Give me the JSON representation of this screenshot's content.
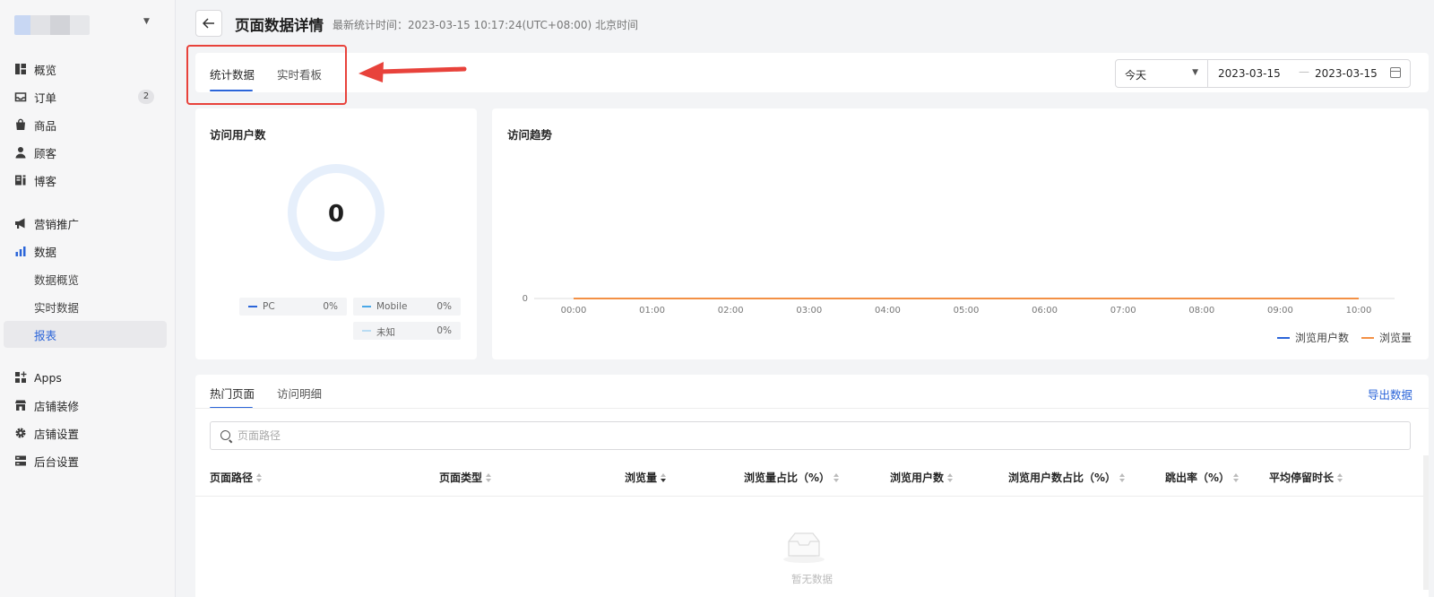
{
  "sidebar": {
    "items": [
      {
        "label": "概览",
        "icon": "dashboard-icon"
      },
      {
        "label": "订单",
        "icon": "inbox-icon",
        "badge": "2"
      },
      {
        "label": "商品",
        "icon": "shopping-bag-icon"
      },
      {
        "label": "顾客",
        "icon": "user-icon"
      },
      {
        "label": "博客",
        "icon": "blog-icon"
      },
      {
        "label": "营销推广",
        "icon": "megaphone-icon"
      },
      {
        "label": "数据",
        "icon": "bar-chart-icon"
      },
      {
        "label": "数据概览"
      },
      {
        "label": "实时数据"
      },
      {
        "label": "报表",
        "active": true
      },
      {
        "label": "Apps",
        "icon": "apps-icon"
      },
      {
        "label": "店铺装修",
        "icon": "storefront-icon"
      },
      {
        "label": "店铺设置",
        "icon": "gear-icon"
      },
      {
        "label": "后台设置",
        "icon": "server-icon"
      }
    ]
  },
  "header": {
    "title": "页面数据详情",
    "stat_time": "最新统计时间：2023-03-15 10:17:24(UTC+08:00) 北京时间"
  },
  "top_tabs": [
    {
      "label": "统计数据",
      "active": true
    },
    {
      "label": "实时看板"
    }
  ],
  "date_filter": {
    "range": "今天",
    "start": "2023-03-15",
    "separator": "—",
    "end": "2023-03-15"
  },
  "visitors_card": {
    "title": "访问用户数",
    "total": "0",
    "legend": [
      {
        "name": "PC",
        "pct": "0%",
        "color": "#2b65d9"
      },
      {
        "name": "Mobile",
        "pct": "0%",
        "color": "#4aa8e8"
      },
      {
        "name": "未知",
        "pct": "0%",
        "color": "#b9dcf3"
      }
    ]
  },
  "trend_card": {
    "title": "访问趋势",
    "chart_data": {
      "type": "line",
      "x": [
        "00:00",
        "01:00",
        "02:00",
        "03:00",
        "04:00",
        "05:00",
        "06:00",
        "07:00",
        "08:00",
        "09:00",
        "10:00"
      ],
      "y_ticks": [
        "0"
      ],
      "series": [
        {
          "name": "浏览用户数",
          "color": "#2b65d9",
          "values": [
            0,
            0,
            0,
            0,
            0,
            0,
            0,
            0,
            0,
            0,
            0
          ]
        },
        {
          "name": "浏览量",
          "color": "#f39045",
          "values": [
            0,
            0,
            0,
            0,
            0,
            0,
            0,
            0,
            0,
            0,
            0
          ]
        }
      ],
      "legend_position": "bottom-right"
    }
  },
  "table_card": {
    "tabs": [
      {
        "label": "热门页面",
        "active": true
      },
      {
        "label": "访问明细"
      }
    ],
    "export_label": "导出数据",
    "search_placeholder": "页面路径",
    "columns": [
      {
        "label": "页面路径",
        "sort": "none"
      },
      {
        "label": "页面类型",
        "sort": "none"
      },
      {
        "label": "浏览量",
        "sort": "desc"
      },
      {
        "label": "浏览量占比（%）",
        "sort": "none"
      },
      {
        "label": "浏览用户数",
        "sort": "none"
      },
      {
        "label": "浏览用户数占比（%）",
        "sort": "none"
      },
      {
        "label": "跳出率（%）",
        "sort": "none"
      },
      {
        "label": "平均停留时长",
        "sort": "none"
      }
    ],
    "empty_text": "暂无数据"
  },
  "colors": {
    "accent": "#2b65d9",
    "annotation": "#e8423b",
    "series_orange": "#f39045"
  }
}
